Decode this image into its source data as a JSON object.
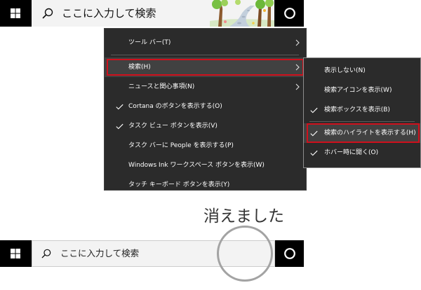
{
  "taskbar_top": {
    "search_placeholder": "ここに入力して検索",
    "show_search_highlight": true,
    "start_icon": "windows-logo-icon",
    "search_icon": "search-icon",
    "cortana_icon": "cortana-icon"
  },
  "context_menu": {
    "check_icon": "checkmark-icon",
    "submenu_icon": "chevron-right-icon",
    "items": [
      {
        "label": "ツール バー(T)",
        "checked": false,
        "has_submenu": true,
        "highlighted": false
      },
      {
        "label": "検索(H)",
        "checked": false,
        "has_submenu": true,
        "highlighted": true
      },
      {
        "label": "ニュースと関心事項(N)",
        "checked": false,
        "has_submenu": true,
        "highlighted": false
      },
      {
        "label": "Cortana のボタンを表示する(O)",
        "checked": true,
        "has_submenu": false,
        "highlighted": false
      },
      {
        "label": "タスク ビュー ボタンを表示(V)",
        "checked": true,
        "has_submenu": false,
        "highlighted": false
      },
      {
        "label": "タスク バーに People を表示する(P)",
        "checked": false,
        "has_submenu": false,
        "highlighted": false
      },
      {
        "label": "Windows Ink ワークスペース ボタンを表示(W)",
        "checked": false,
        "has_submenu": false,
        "highlighted": false
      },
      {
        "label": "タッチ キーボード ボタンを表示(Y)",
        "checked": false,
        "has_submenu": false,
        "highlighted": false
      }
    ]
  },
  "search_submenu": {
    "items": [
      {
        "label": "表示しない(N)",
        "checked": false,
        "highlighted": false
      },
      {
        "label": "検索アイコンを表示(W)",
        "checked": false,
        "highlighted": false
      },
      {
        "label": "検索ボックスを表示(B)",
        "checked": true,
        "highlighted": false
      },
      {
        "label": "検索のハイライトを表示する(H)",
        "checked": true,
        "highlighted": true
      },
      {
        "label": "ホバー時に開く(O)",
        "checked": true,
        "highlighted": false
      }
    ]
  },
  "caption": "消えました",
  "taskbar_bottom": {
    "search_placeholder": "ここに入力して検索",
    "show_search_highlight": false,
    "start_icon": "windows-logo-icon",
    "search_icon": "search-icon",
    "cortana_icon": "cortana-icon"
  },
  "colors": {
    "taskbar": "#000000",
    "search_bg": "#f3f3f3",
    "menu_bg": "#2b2b2b",
    "menu_hover": "#414141",
    "menu_text": "#ffffff",
    "annot_red": "#d0101c",
    "annot_circle": "#a3a3a3",
    "caption": "#333333"
  }
}
